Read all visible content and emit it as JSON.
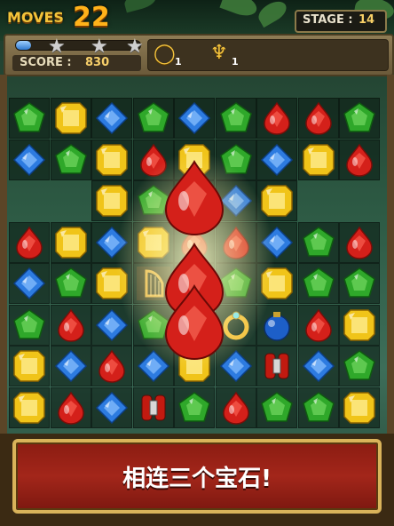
{
  "hud": {
    "moves_label": "MOVES",
    "moves_value": "22",
    "stage_label": "STAGE :",
    "stage_value": "14",
    "score_label": "SCORE :",
    "score_value": "830",
    "progress_fraction": 0.12,
    "stars": [
      "star",
      "star",
      "star"
    ]
  },
  "goals": [
    {
      "icon": "ring-icon",
      "count": "1"
    },
    {
      "icon": "harp-icon",
      "count": "1"
    }
  ],
  "banner": {
    "text": "相连三个宝石!"
  },
  "board": {
    "rows": [
      [
        "green",
        "yellow",
        "blue",
        "green",
        "blue",
        "green",
        "red",
        "red",
        "green"
      ],
      [
        "blue",
        "green",
        "yellow",
        "red",
        "yellow",
        "green",
        "blue",
        "yellow",
        "red"
      ],
      [
        "empty",
        "empty",
        "yellow",
        "green",
        "red",
        "blue",
        "yellow",
        "empty",
        "empty"
      ],
      [
        "red",
        "yellow",
        "blue",
        "yellow",
        "red",
        "red",
        "blue",
        "green",
        "red"
      ],
      [
        "blue",
        "green",
        "yellow",
        "harp",
        "red",
        "green",
        "yellow",
        "green",
        "green"
      ],
      [
        "green",
        "red",
        "blue",
        "green",
        "red",
        "ring",
        "bomb",
        "red",
        "yellow"
      ],
      [
        "yellow",
        "blue",
        "red",
        "blue",
        "yellow",
        "blue",
        "barrel",
        "blue",
        "green"
      ],
      [
        "yellow",
        "red",
        "blue",
        "barrel",
        "green",
        "red",
        "green",
        "green",
        "yellow"
      ]
    ],
    "highlight": {
      "color": "red",
      "column": 4,
      "rows": [
        2,
        4,
        5
      ]
    }
  },
  "colors": {
    "red": "#d4201a",
    "green": "#2fa82a",
    "blue": "#2d7be0",
    "yellow": "#f0c419",
    "banner": "#a3261a",
    "accent": "#f3c33a"
  }
}
